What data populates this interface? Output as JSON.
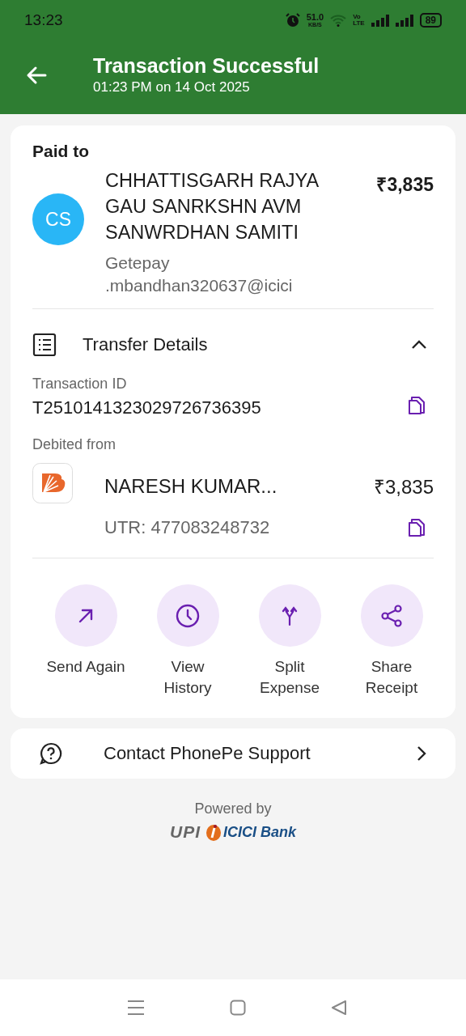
{
  "status_bar": {
    "time": "13:23",
    "speed": "51.0",
    "speed_unit": "KB/S",
    "network": "Vo",
    "network_type": "LTE",
    "battery": "89"
  },
  "header": {
    "title": "Transaction Successful",
    "subtitle": "01:23 PM on 14 Oct 2025"
  },
  "paid_to": {
    "label": "Paid to",
    "initials": "CS",
    "name": "CHHATTISGARH RAJYA GAU SANRKSHN AVM SANWRDHAN SAMITI",
    "amount": "₹3,835",
    "upi_id": "Getepay\n.mbandhan320637@icici"
  },
  "transfer_details": {
    "title": "Transfer Details",
    "expanded": true,
    "transaction_id_label": "Transaction ID",
    "transaction_id": "T2510141323029726736395",
    "debited_label": "Debited from",
    "account_name": "NARESH KUMAR...",
    "account_amount": "₹3,835",
    "utr": "UTR: 477083248732"
  },
  "actions": [
    {
      "kind": "send",
      "label": "Send Again"
    },
    {
      "kind": "history",
      "label": "View\nHistory"
    },
    {
      "kind": "split",
      "label": "Split\nExpense"
    },
    {
      "kind": "share",
      "label": "Share\nReceipt"
    }
  ],
  "support": {
    "label": "Contact PhonePe Support"
  },
  "footer": {
    "powered_by": "Powered by",
    "upi_logo": "UPI",
    "bank_logo": "ICICI Bank"
  }
}
